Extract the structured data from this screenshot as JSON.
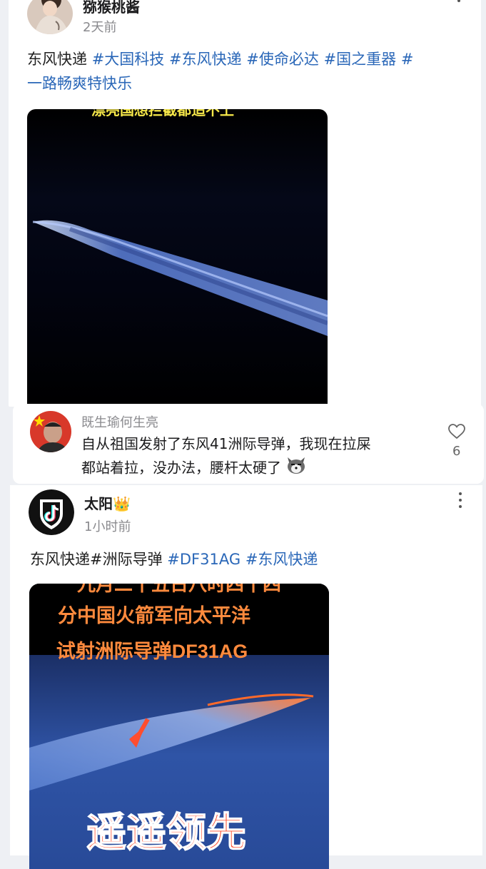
{
  "post1": {
    "username": "猕猴桃酱",
    "time": "2天前",
    "text_plain": "东风快递",
    "tags_line1": [
      "#大国科技",
      "#东风快递",
      "#使命必达",
      "#国之重器",
      "#"
    ],
    "tags_line2": "一路畅爽特快乐",
    "media_caption_partial": "漂亮国想拦截都追不上"
  },
  "comment": {
    "username": "既生瑜何生亮",
    "text_line1": "自从祖国发射了东风41洲际导弹，我现在拉屎",
    "text_line2": "都站着拉，没办法，腰杆太硬了",
    "likes": "6"
  },
  "post2": {
    "username": "太阳",
    "crown": "👑",
    "time": "1小时前",
    "text_plain": "东风快递#洲际导弹 ",
    "tags": [
      "#DF31AG",
      "#东风快递"
    ],
    "media_caption_top_partial": "九月二十五日八时四十四",
    "media_caption_line2": "分中国火箭军向太平洋",
    "media_caption_line3": "试射洲际导弹DF31AG",
    "media_caption_big": "遥遥领先"
  },
  "colors": {
    "tag": "#2a67b8",
    "caption_orange": "#ff8a3d",
    "caption_yellow": "#f7e94a"
  }
}
